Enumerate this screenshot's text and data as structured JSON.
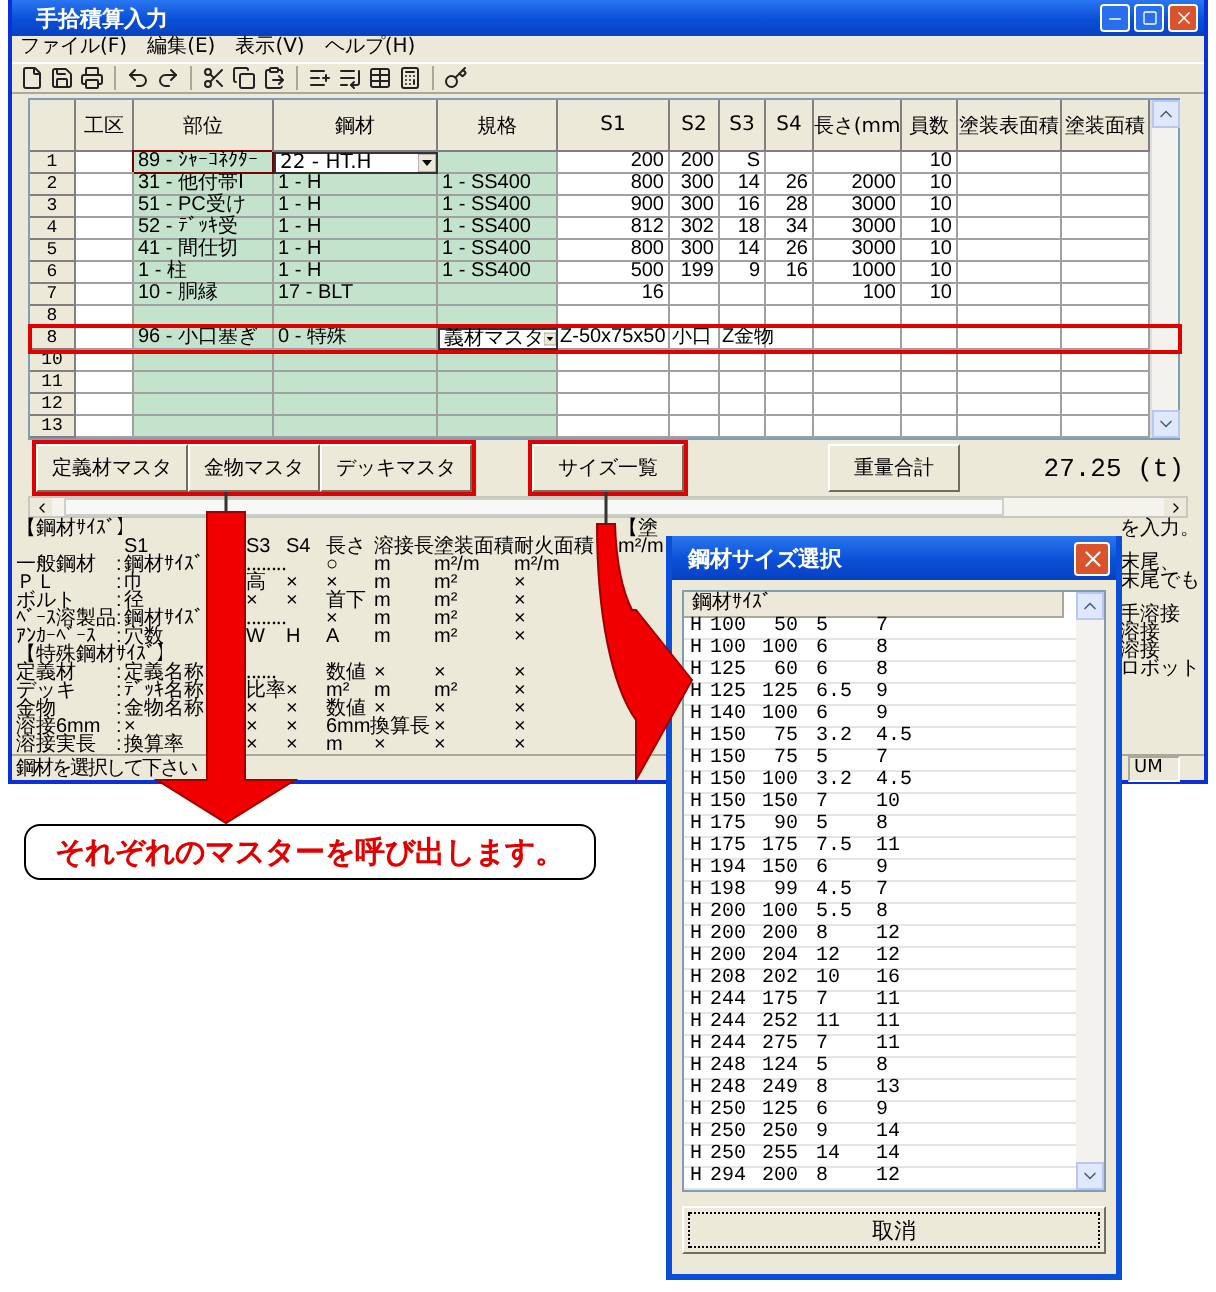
{
  "window": {
    "title": "手拾積算入力"
  },
  "menu": [
    "ファイル(F)",
    "編集(E)",
    "表示(V)",
    "ヘルプ(H)"
  ],
  "grid": {
    "columns": [
      {
        "label": "工区",
        "editable": false
      },
      {
        "label": "部位",
        "editable": true
      },
      {
        "label": "鋼材",
        "editable": true
      },
      {
        "label": "規格",
        "editable": true
      },
      {
        "label": "S1",
        "editable": false
      },
      {
        "label": "S2",
        "editable": false
      },
      {
        "label": "S3",
        "editable": false
      },
      {
        "label": "S4",
        "editable": false
      },
      {
        "label": "長さ(mm",
        "editable": false
      },
      {
        "label": "員数",
        "editable": false
      },
      {
        "label": "塗装表面積",
        "editable": false
      },
      {
        "label": "塗装面積",
        "editable": false
      }
    ],
    "rows": [
      {
        "no": "1",
        "highlighted": false,
        "cells": [
          null,
          {
            "text": "89 - ｼｬｰｺﾈｸﾀｰ",
            "kind": "focused"
          },
          {
            "text": "22 - HT.H",
            "kind": "dropdown"
          },
          null,
          "200",
          "200",
          "S",
          null,
          null,
          "10",
          null,
          null
        ]
      },
      {
        "no": "2",
        "highlighted": false,
        "cells": [
          null,
          "31 - 他付帯Ⅰ",
          "1 - H",
          "1 - SS400",
          "800",
          "300",
          "14",
          "26",
          "2000",
          "10",
          null,
          null
        ]
      },
      {
        "no": "3",
        "highlighted": false,
        "cells": [
          null,
          "51 - PC受け",
          "1 - H",
          "1 - SS400",
          "900",
          "300",
          "16",
          "28",
          "3000",
          "10",
          null,
          null
        ]
      },
      {
        "no": "4",
        "highlighted": false,
        "cells": [
          null,
          "52 - ﾃﾞｯｷ受",
          "1 - H",
          "1 - SS400",
          "812",
          "302",
          "18",
          "34",
          "3000",
          "10",
          null,
          null
        ]
      },
      {
        "no": "5",
        "highlighted": false,
        "cells": [
          null,
          "41 - 間仕切",
          "1 - H",
          "1 - SS400",
          "800",
          "300",
          "14",
          "26",
          "3000",
          "10",
          null,
          null
        ]
      },
      {
        "no": "6",
        "highlighted": false,
        "cells": [
          null,
          "1 - 柱",
          "1 - H",
          "1 - SS400",
          "500",
          "199",
          "9",
          "16",
          "1000",
          "10",
          null,
          null
        ]
      },
      {
        "no": "7",
        "highlighted": false,
        "cells": [
          null,
          "10 - 胴縁",
          "17 - BLT",
          null,
          "16",
          null,
          null,
          null,
          "100",
          "10",
          null,
          null
        ]
      },
      {
        "no": "8",
        "highlighted": false,
        "cells": [
          null,
          null,
          null,
          null,
          null,
          null,
          null,
          null,
          null,
          null,
          null,
          null
        ]
      },
      {
        "no": "8",
        "highlighted": true,
        "cells": [
          null,
          "96 - 小口塞ぎ",
          "0 - 特殊",
          {
            "text": "義材マスタ",
            "kind": "dropdown"
          },
          {
            "text": "Z-50x75x50",
            "kind": "free_text"
          },
          {
            "text": "小口",
            "kind": "free_text"
          },
          {
            "text": "Z金物",
            "kind": "free_text"
          },
          null,
          null,
          null,
          null,
          null
        ]
      },
      {
        "no": "10",
        "highlighted": false,
        "cells": [
          null,
          null,
          null,
          null,
          null,
          null,
          null,
          null,
          null,
          null,
          null,
          null
        ]
      },
      {
        "no": "11",
        "highlighted": false,
        "cells": [
          null,
          null,
          null,
          null,
          null,
          null,
          null,
          null,
          null,
          null,
          null,
          null
        ]
      },
      {
        "no": "12",
        "highlighted": false,
        "cells": [
          null,
          null,
          null,
          null,
          null,
          null,
          null,
          null,
          null,
          null,
          null,
          null
        ]
      },
      {
        "no": "13",
        "highlighted": false,
        "cells": [
          null,
          null,
          null,
          null,
          null,
          null,
          null,
          null,
          null,
          null,
          null,
          null
        ]
      }
    ]
  },
  "master_buttons": {
    "highlighted": true,
    "items": [
      "定義材マスタ",
      "金物マスタ",
      "デッキマスタ"
    ]
  },
  "size_button": {
    "label": "サイズ一覧",
    "highlighted": true
  },
  "total_button": {
    "label": "重量合計"
  },
  "total_value": "27.25 (t)",
  "legend": {
    "sections": [
      {
        "heading": "【鋼材ｻｲｽﾞ】",
        "rows": [
          [
            null,
            null,
            "S1",
            null,
            "S3",
            "S4",
            "長さ",
            "溶接長",
            "塗装面積",
            "耐火面積"
          ],
          [
            "一般鋼材",
            ":",
            "鋼材ｻｲｽﾞ",
            null,
            "‥‥‥‥",
            null,
            "○",
            "m",
            "m²/m",
            "m²/m"
          ],
          [
            "ＰＬ",
            ":",
            "巾",
            null,
            "高",
            "×",
            "×",
            "m",
            "m²",
            "×"
          ],
          [
            "ボルト",
            ":",
            "径",
            null,
            "×",
            "×",
            "首下",
            "m",
            "m²",
            "×"
          ],
          [
            "ﾍﾞｰｽ溶製品",
            ":",
            "鋼材ｻｲｽﾞ",
            null,
            "‥‥‥‥",
            null,
            "×",
            "m",
            "m²",
            "×"
          ],
          [
            "ｱﾝｶｰﾍﾞｰｽ",
            ":",
            "穴数",
            null,
            "W",
            "H",
            "A",
            "m",
            "m²",
            "×"
          ]
        ]
      },
      {
        "heading": "【特殊鋼材ｻｲｽﾞ】",
        "rows": [
          [
            "定義材",
            ":",
            "定義名称",
            null,
            "‥‥‥",
            null,
            "数値",
            "×",
            "×",
            "×"
          ],
          [
            "デッキ",
            ":",
            "ﾃﾞｯｷ名称",
            null,
            "比率",
            "×",
            "m²",
            "m",
            "m²",
            "×"
          ],
          [
            "金物",
            ":",
            "金物名称",
            null,
            "×",
            "×",
            "数値",
            "×",
            "×",
            "×"
          ],
          [
            "溶接6mm",
            ":",
            "×",
            null,
            "×",
            "×",
            "6mm換算長",
            null,
            "×",
            "×"
          ],
          [
            "溶接実長",
            ":",
            "換算率",
            null,
            "×",
            "×",
            "m",
            "×",
            "×",
            "×"
          ]
        ]
      }
    ],
    "middle_notes": [
      [
        "【塗",
        "m²/m"
      ]
    ],
    "right_notes": [
      [
        "を入力。"
      ],
      [
        "末尾、",
        "末尾でも"
      ],
      [
        "手溶接",
        "溶接",
        "溶接",
        "ロボット"
      ]
    ]
  },
  "status_bar": {
    "message": "鋼材を選択して下さい",
    "panel": "UM"
  },
  "dialog": {
    "title": "鋼材サイズ選択",
    "header": "鋼材ｻｲｽﾞ",
    "rows": [
      [
        "H",
        "100",
        "50",
        "5",
        "7"
      ],
      [
        "H",
        "100",
        "100",
        "6",
        "8"
      ],
      [
        "H",
        "125",
        "60",
        "6",
        "8"
      ],
      [
        "H",
        "125",
        "125",
        "6.5",
        "9"
      ],
      [
        "H",
        "140",
        "100",
        "6",
        "9"
      ],
      [
        "H",
        "150",
        "75",
        "3.2",
        "4.5"
      ],
      [
        "H",
        "150",
        "75",
        "5",
        "7"
      ],
      [
        "H",
        "150",
        "100",
        "3.2",
        "4.5"
      ],
      [
        "H",
        "150",
        "150",
        "7",
        "10"
      ],
      [
        "H",
        "175",
        "90",
        "5",
        "8"
      ],
      [
        "H",
        "175",
        "175",
        "7.5",
        "11"
      ],
      [
        "H",
        "194",
        "150",
        "6",
        "9"
      ],
      [
        "H",
        "198",
        "99",
        "4.5",
        "7"
      ],
      [
        "H",
        "200",
        "100",
        "5.5",
        "8"
      ],
      [
        "H",
        "200",
        "200",
        "8",
        "12"
      ],
      [
        "H",
        "200",
        "204",
        "12",
        "12"
      ],
      [
        "H",
        "208",
        "202",
        "10",
        "16"
      ],
      [
        "H",
        "244",
        "175",
        "7",
        "11"
      ],
      [
        "H",
        "244",
        "252",
        "11",
        "11"
      ],
      [
        "H",
        "244",
        "275",
        "7",
        "11"
      ],
      [
        "H",
        "248",
        "124",
        "5",
        "8"
      ],
      [
        "H",
        "248",
        "249",
        "8",
        "13"
      ],
      [
        "H",
        "250",
        "125",
        "6",
        "9"
      ],
      [
        "H",
        "250",
        "250",
        "9",
        "14"
      ],
      [
        "H",
        "250",
        "255",
        "14",
        "14"
      ],
      [
        "H",
        "294",
        "200",
        "8",
        "12"
      ]
    ],
    "cancel": "取消"
  },
  "callout": "それぞれのマスターを呼び出します。"
}
